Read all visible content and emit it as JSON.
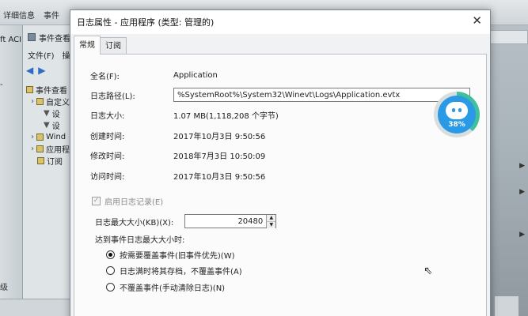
{
  "background": {
    "top_labels": [
      "详细信息",
      "事件"
    ],
    "left_acl": "ft ACI",
    "left_dash": "-",
    "bottom_left": "级",
    "ev_window": {
      "title": "事件查看",
      "menu": [
        "文件(F)",
        "操"
      ],
      "tree": [
        "事件查看",
        "自定义",
        "设",
        "设",
        "Wind",
        "应用程",
        "订阅"
      ]
    }
  },
  "dialog": {
    "title": "日志属性 - 应用程序 (类型: 管理的)",
    "close_glyph": "✕",
    "tabs": [
      "常规",
      "订阅"
    ],
    "fields": {
      "full_name": {
        "label": "全名(F):",
        "value": "Application"
      },
      "log_path": {
        "label": "日志路径(L):",
        "value": "%SystemRoot%\\System32\\Winevt\\Logs\\Application.evtx"
      },
      "log_size": {
        "label": "日志大小:",
        "value": "1.07 MB(1,118,208 个字节)"
      },
      "created": {
        "label": "创建时间:",
        "value": "2017年10月3日 9:50:56"
      },
      "modified": {
        "label": "修改时间:",
        "value": "2018年7月3日 10:50:09"
      },
      "accessed": {
        "label": "访问时间:",
        "value": "2017年10月3日 9:50:56"
      }
    },
    "enable_logging": {
      "label": "启用日志记录(E)",
      "checked": true,
      "disabled": true
    },
    "max_size": {
      "label": "日志最大大小(KB)(X):",
      "value": "20480"
    },
    "reach_label": "达到事件日志最大大小时:",
    "options": [
      {
        "label": "按需要覆盖事件(旧事件优先)(W)",
        "selected": true
      },
      {
        "label": "日志满时将其存档，不覆盖事件(A)",
        "selected": false
      },
      {
        "label": "不覆盖事件(手动清除日志)(N)",
        "selected": false
      }
    ]
  },
  "widget": {
    "percent": "38%",
    "ring_color": "#3fc19b",
    "fill_color": "#2a9ae6"
  }
}
